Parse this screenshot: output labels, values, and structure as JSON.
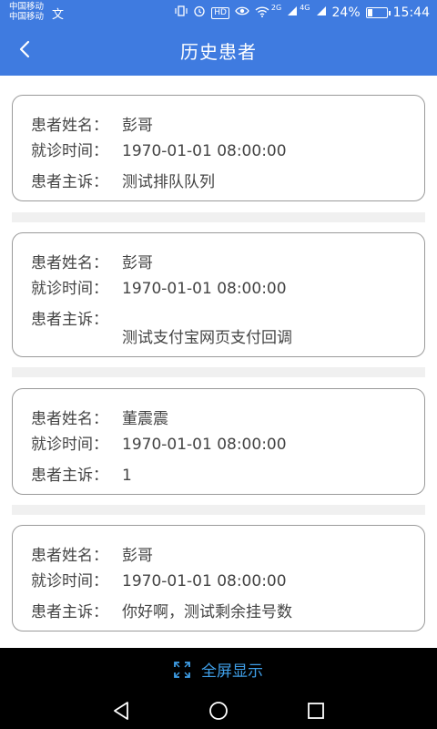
{
  "status_bar": {
    "carrier1": "中国移动",
    "carrier2": "中国移动",
    "battery": "24%",
    "time": "15:44",
    "hd": "HD",
    "net1": "2G",
    "net2": "4G",
    "battery_level": 0.24
  },
  "app_bar": {
    "title": "历史患者"
  },
  "labels": {
    "name": "患者姓名：",
    "time": "就诊时间：",
    "complaint": "患者主诉："
  },
  "patients": [
    {
      "name": "彭哥",
      "visit_time": "1970-01-01 08:00:00",
      "complaint": "测试排队队列"
    },
    {
      "name": "彭哥",
      "visit_time": "1970-01-01 08:00:00",
      "complaint": "测试支付宝网页支付回调"
    },
    {
      "name": "董震震",
      "visit_time": "1970-01-01 08:00:00",
      "complaint": "1"
    },
    {
      "name": "彭哥",
      "visit_time": "1970-01-01 08:00:00",
      "complaint": "你好啊，测试剩余挂号数"
    }
  ],
  "fullscreen": {
    "label": "全屏显示"
  },
  "colors": {
    "primary": "#3f7be0",
    "fullscreen_text": "#3f9fe8"
  }
}
